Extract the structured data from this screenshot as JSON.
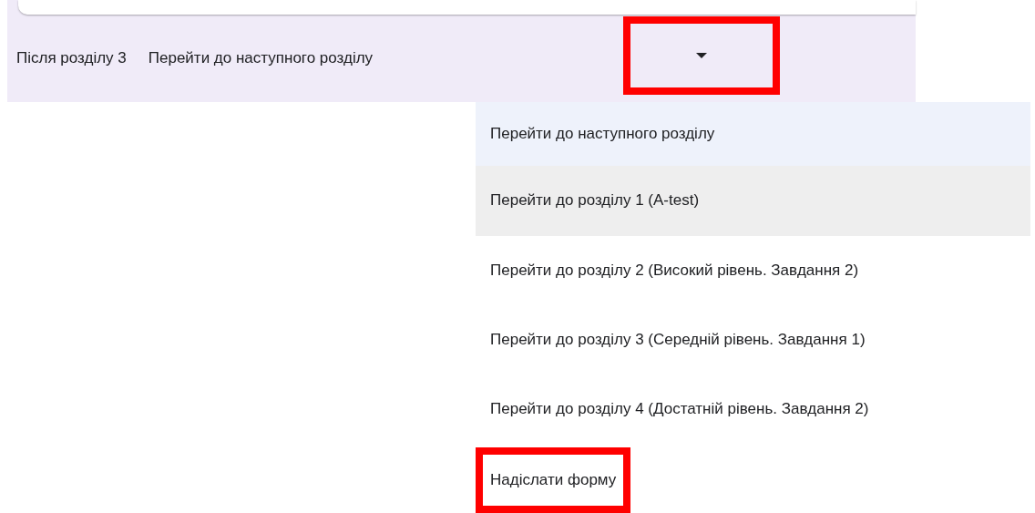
{
  "section_navigation": {
    "label": "Після розділу 3",
    "value": "Перейти до наступного розділу",
    "dropdown_highlighted": true
  },
  "menu": {
    "items": [
      {
        "label": "Перейти до наступного розділу",
        "selected": true,
        "hovered": false,
        "highlighted": false
      },
      {
        "label": "Перейти до розділу 1 (A-test)",
        "selected": false,
        "hovered": true,
        "highlighted": false
      },
      {
        "label": "Перейти до розділу 2 (Високий рівень. Завдання 2)",
        "selected": false,
        "hovered": false,
        "highlighted": false
      },
      {
        "label": "Перейти до розділу 3 (Середній рівень. Завдання 1)",
        "selected": false,
        "hovered": false,
        "highlighted": false
      },
      {
        "label": "Перейти до розділу 4 (Достатній рівень. Завдання 2)",
        "selected": false,
        "hovered": false,
        "highlighted": false
      },
      {
        "label": "Надіслати форму",
        "selected": false,
        "hovered": false,
        "highlighted": true
      }
    ]
  }
}
